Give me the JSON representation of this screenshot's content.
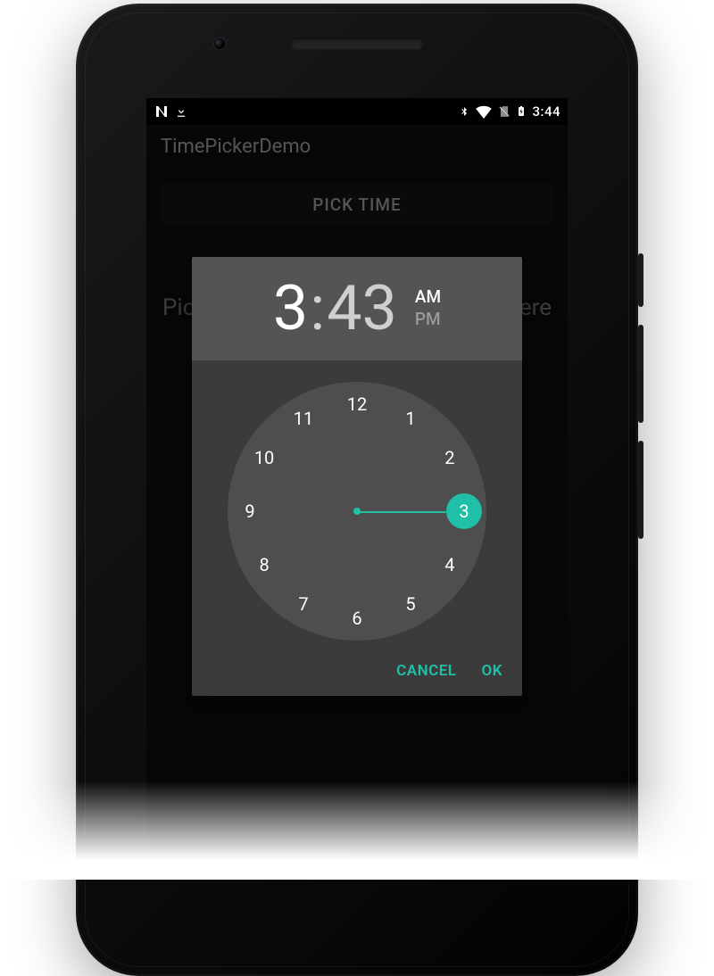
{
  "statusbar": {
    "clock": "3:44",
    "icons_left": [
      "android-n-icon",
      "download-icon"
    ],
    "icons_right": [
      "bluetooth-icon",
      "wifi-icon",
      "no-sim-icon",
      "battery-charging-icon"
    ]
  },
  "appbar": {
    "title": "TimePickerDemo"
  },
  "content": {
    "pick_button": "PICK TIME",
    "placeholder_left": "Pick",
    "placeholder_right": "ere"
  },
  "dialog": {
    "hour": "3",
    "minute": "43",
    "colon": ":",
    "am_label": "AM",
    "pm_label": "PM",
    "period": "AM",
    "selected_hour": 3,
    "clock_numbers": [
      "12",
      "1",
      "2",
      "3",
      "4",
      "5",
      "6",
      "7",
      "8",
      "9",
      "10",
      "11"
    ],
    "actions": {
      "cancel": "CANCEL",
      "ok": "OK"
    }
  }
}
